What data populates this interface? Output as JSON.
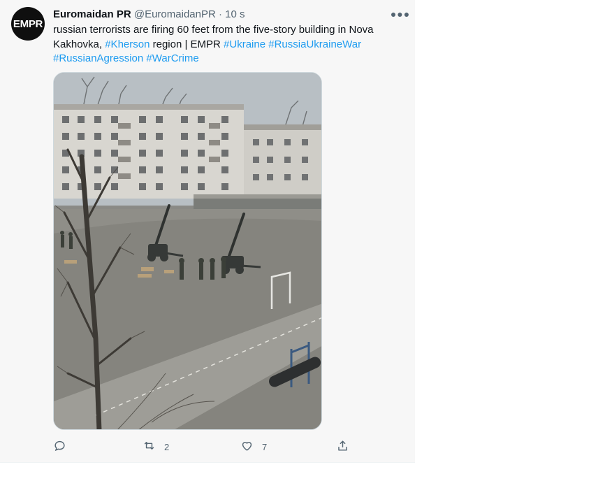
{
  "tweet": {
    "avatar_text": "EMPR",
    "display_name": "Euromaidan PR",
    "handle": "@EuromaidanPR",
    "separator": "·",
    "time": "10 s",
    "more_icon": "more-horizontal-icon",
    "text": {
      "line1": "russian terrorists are firing 60 feet from the five-story building in Nova",
      "line2_prefix": "Kakhovka, ",
      "hashtag_kherson": "#Kherson",
      "line2_middle": " region | EMPR ",
      "hashtag_ukraine": "#Ukraine",
      "hashtag_war": "#RussiaUkraineWar",
      "hashtag_agression": "#RussianAgression",
      "hashtag_warcrime": "#WarCrime"
    },
    "media_description_icon": "photo",
    "actions": {
      "reply_icon": "reply-icon",
      "retweet_icon": "retweet-icon",
      "retweet_count": "2",
      "like_icon": "heart-icon",
      "like_count": "7",
      "share_icon": "share-icon"
    }
  },
  "colors": {
    "link": "#1d9bf0",
    "secondary_text": "#536471",
    "primary_text": "#0f1419",
    "tweet_background": "#f7f7f7"
  }
}
